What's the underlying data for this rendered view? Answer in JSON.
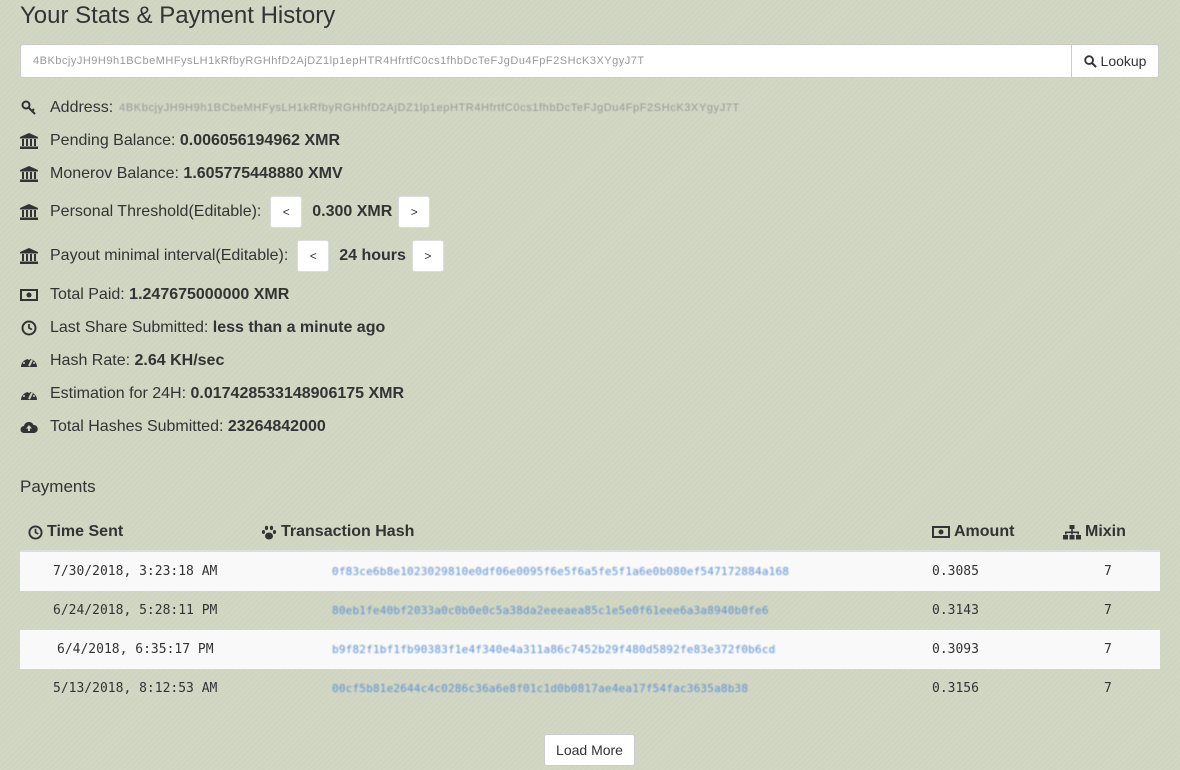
{
  "page": {
    "title": "Your Stats & Payment History"
  },
  "lookup": {
    "address_value": "4BKbcjyJH9H9h1BCbeMHFysLH1kRfbyRGHhfD2AjDZ1lp1epHTR4HfrtfC0cs1fhbDcTeFJgDu4FpF2SHcK3XYgyJ7T",
    "button_label": "Lookup",
    "button_icon": "search-icon"
  },
  "stats": {
    "address": {
      "label": "Address:",
      "value": "4BKbcjyJH9H9h1BCbeMHFysLH1kRfbyRGHhfD2AjDZ1lp1epHTR4HfrtfC0cs1fhbDcTeFJgDu4FpF2SHcK3XYgyJ7T",
      "icon": "key-icon"
    },
    "pending_balance": {
      "label": "Pending Balance:",
      "value": "0.006056194962 XMR",
      "icon": "bank-icon"
    },
    "monerov_balance": {
      "label": "Monerov Balance:",
      "value": "1.605775448880 XMV",
      "icon": "bank-icon"
    },
    "personal_threshold": {
      "label": "Personal Threshold(Editable):",
      "value": "0.300 XMR",
      "dec": "<",
      "inc": ">",
      "icon": "bank-icon"
    },
    "payout_interval": {
      "label": "Payout minimal interval(Editable):",
      "value": "24 hours",
      "dec": "<",
      "inc": ">",
      "icon": "bank-icon"
    },
    "total_paid": {
      "label": "Total Paid:",
      "value": "1.247675000000 XMR",
      "icon": "money-icon"
    },
    "last_share": {
      "label": "Last Share Submitted:",
      "value": "less than a minute ago",
      "icon": "clock-icon"
    },
    "hash_rate": {
      "label": "Hash Rate:",
      "value": "2.64 KH/sec",
      "icon": "dashboard-icon"
    },
    "estimation": {
      "label": "Estimation for 24H:",
      "value": "0.017428533148906175 XMR",
      "icon": "dashboard-icon"
    },
    "total_hashes": {
      "label": "Total Hashes Submitted:",
      "value": "23264842000",
      "icon": "cloud-upload-icon"
    }
  },
  "payments": {
    "title": "Payments",
    "columns": {
      "time_sent": "Time Sent",
      "tx_hash": "Transaction Hash",
      "amount": "Amount",
      "mixin": "Mixin"
    },
    "rows": [
      {
        "time": "7/30/2018, 3:23:18 AM",
        "hash": "0f83ce6b8e1023029810e0df06e0095f6e5f6a5fe5f1a6e0b080ef547172884a168",
        "amount": "0.3085",
        "mixin": "7"
      },
      {
        "time": "6/24/2018, 5:28:11 PM",
        "hash": "80eb1fe40bf2033a0c0b0e0c5a38da2eeeaea85c1e5e0f61eee6a3a8940b0fe6",
        "amount": "0.3143",
        "mixin": "7"
      },
      {
        "time": "6/4/2018, 6:35:17 PM",
        "hash": "b9f82f1bf1fb90383f1e4f340e4a311a86c7452b29f480d5892fe83e372f0b6cd",
        "amount": "0.3093",
        "mixin": "7"
      },
      {
        "time": "5/13/2018, 8:12:53 AM",
        "hash": "00cf5b81e2644c4c0286c36a6e8f01c1d0b0817ae4ea17f54fac3635a8b38",
        "amount": "0.3156",
        "mixin": "7"
      }
    ],
    "load_more": "Load More"
  },
  "colors": {
    "background": "#cfd5c1",
    "link": "#5b8fd0",
    "row_stripe": "#f9f9f9"
  }
}
